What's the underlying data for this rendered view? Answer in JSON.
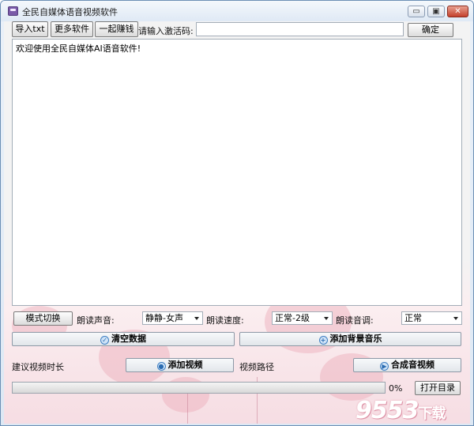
{
  "window": {
    "title": "全民自媒体语音视频软件",
    "min_glyph": "▭",
    "max_glyph": "▣",
    "close_glyph": "✕"
  },
  "toolbar": {
    "import_label": "导入txt",
    "more_label": "更多软件",
    "earn_label": "一起赚钱",
    "activation_label": "请输入激活码:",
    "activation_value": "",
    "confirm_label": "确定"
  },
  "content": {
    "welcome_text": "欢迎使用全民自媒体AI语音软件!"
  },
  "controls": {
    "mode_label": "模式切换",
    "voice_label": "朗读声音:",
    "voice_value": "静静-女声",
    "speed_label": "朗读速度:",
    "speed_value": "正常-2级",
    "tone_label": "朗读音调:",
    "tone_value": "正常",
    "clear_label": "清空数据",
    "bgm_label": "添加背景音乐",
    "duration_label": "建议视频时长",
    "add_video_label": "添加视频",
    "video_path_label": "视频路径",
    "compose_label": "合成音视频",
    "open_dir_label": "打开目录"
  },
  "progress": {
    "value": 0,
    "text": "0%"
  },
  "watermark": {
    "text": "9553",
    "suffix": "下载"
  },
  "colors": {
    "accent_blue": "#3f7fc2",
    "progress_green": "#3e9d2a",
    "close_red": "#c4402c"
  }
}
